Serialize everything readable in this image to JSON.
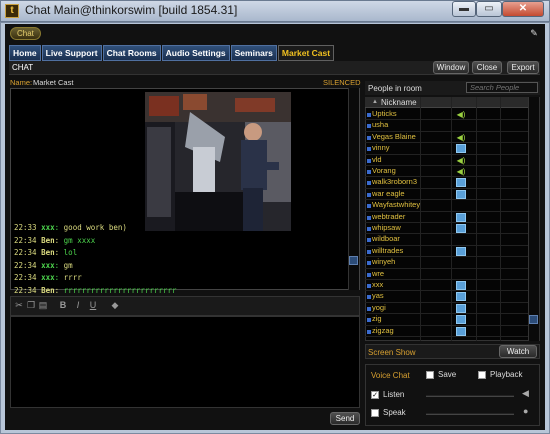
{
  "window": {
    "title": "Chat Main@thinkorswim [build 1854.31]",
    "min_glyph": "▬",
    "max_glyph": "▭",
    "close_glyph": "✕",
    "logo_glyph": "t"
  },
  "chat_pill": "Chat",
  "tabs": [
    {
      "label": "Home",
      "active": false
    },
    {
      "label": "Live Support",
      "active": false
    },
    {
      "label": "Chat Rooms",
      "active": false
    },
    {
      "label": "Audio Settings",
      "active": false
    },
    {
      "label": "Seminars",
      "active": false
    },
    {
      "label": "Market Cast",
      "active": true
    }
  ],
  "header": {
    "title": "CHAT",
    "window_label": "Window",
    "close_label": "Close",
    "export_label": "Export"
  },
  "room": {
    "name_label": "Name:",
    "name_value": "Market Cast",
    "silenced": "SILENCED"
  },
  "messages": [
    {
      "time": "22:33",
      "user": "xxx",
      "text": "good work ben)",
      "user_color": "#4cd34c",
      "text_color": "#dcdc80"
    },
    {
      "time": "22:34",
      "user": "Ben",
      "text": "gm xxxx",
      "user_color": "#dcdc80",
      "text_color": "#4cd34c"
    },
    {
      "time": "22:34",
      "user": "Ben",
      "text": "lol",
      "user_color": "#dcdc80",
      "text_color": "#4cd34c"
    },
    {
      "time": "22:34",
      "user": "xxx",
      "text": "gm",
      "user_color": "#4cd34c",
      "text_color": "#dcdc80"
    },
    {
      "time": "22:34",
      "user": "xxx",
      "text": "rrrr",
      "user_color": "#4cd34c",
      "text_color": "#dcdc80"
    },
    {
      "time": "22:34",
      "user": "Ben",
      "text": "rrrrrrrrrrrrrrrrrrrrrrrrr",
      "user_color": "#dcdc80",
      "text_color": "#4cd34c"
    }
  ],
  "editor_toolbar": [
    "scissors-icon",
    "copy-icon",
    "paste-icon",
    "bold-icon",
    "italic-icon",
    "underline-icon",
    "eraser-icon"
  ],
  "send_label": "Send",
  "people": {
    "label": "People in room",
    "search_placeholder": "Search People",
    "column_nickname": "Nickname",
    "members": [
      {
        "nick": "Upticks",
        "status": "speaker"
      },
      {
        "nick": "usha",
        "status": ""
      },
      {
        "nick": "Vegas Blaine",
        "status": "speaker"
      },
      {
        "nick": "vinny",
        "status": "tv"
      },
      {
        "nick": "vld",
        "status": "speaker"
      },
      {
        "nick": "Vorang",
        "status": "speaker"
      },
      {
        "nick": "walk3roborn3",
        "status": "tv"
      },
      {
        "nick": "war eagle",
        "status": "tv"
      },
      {
        "nick": "Wayfastwhitey",
        "status": ""
      },
      {
        "nick": "webtrader",
        "status": "tv"
      },
      {
        "nick": "whipsaw",
        "status": "tv"
      },
      {
        "nick": "wildboar",
        "status": ""
      },
      {
        "nick": "willtrades",
        "status": "tv"
      },
      {
        "nick": "winyeh",
        "status": ""
      },
      {
        "nick": "wre",
        "status": ""
      },
      {
        "nick": "xxx",
        "status": "tv"
      },
      {
        "nick": "yas",
        "status": "tv"
      },
      {
        "nick": "yogi",
        "status": "tv"
      },
      {
        "nick": "zig",
        "status": "tv"
      },
      {
        "nick": "zigzag",
        "status": "tv"
      }
    ]
  },
  "screen_show": {
    "label": "Screen Show",
    "watch_label": "Watch"
  },
  "voice": {
    "label": "Voice Chat",
    "save_label": "Save",
    "playback_label": "Playback",
    "listen_label": "Listen",
    "speak_label": "Speak",
    "save_checked": false,
    "playback_checked": false,
    "listen_checked": true,
    "speak_checked": false
  },
  "colors": {
    "accent_gold": "#f0c020",
    "nick_gold": "#e0c040",
    "tab_blue": "#1b3050",
    "msg_green": "#4cd34c"
  }
}
